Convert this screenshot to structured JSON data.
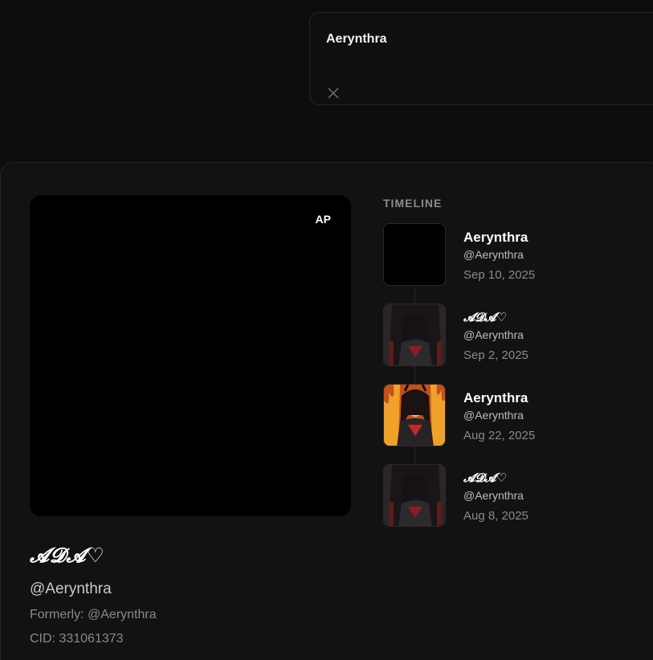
{
  "search_card": {
    "title": "Aerynthra"
  },
  "profile": {
    "avatar_badge": "AP",
    "display_name": "𝓐𝓓𝓐♡",
    "handle": "@Aerynthra",
    "formerly": "Formerly: @Aerynthra",
    "cid": "CID: 331061373"
  },
  "timeline": {
    "label": "TIMELINE",
    "items": [
      {
        "name": "Aerynthra",
        "handle": "@Aerynthra",
        "date": "Sep 10, 2025",
        "thumb": "blank"
      },
      {
        "name": "𝓐𝓓𝓐♡",
        "handle": "@Aerynthra",
        "date": "Sep 2, 2025",
        "thumb": "dark-portrait"
      },
      {
        "name": "Aerynthra",
        "handle": "@Aerynthra",
        "date": "Aug 22, 2025",
        "thumb": "fire-portrait"
      },
      {
        "name": "𝓐𝓓𝓐♡",
        "handle": "@Aerynthra",
        "date": "Aug 8, 2025",
        "thumb": "dark-portrait"
      }
    ]
  },
  "icons": {
    "close": "close-icon"
  },
  "colors": {
    "background": "#0d0d0d",
    "panel": "#121212",
    "muted_text": "#8a8a8a"
  }
}
